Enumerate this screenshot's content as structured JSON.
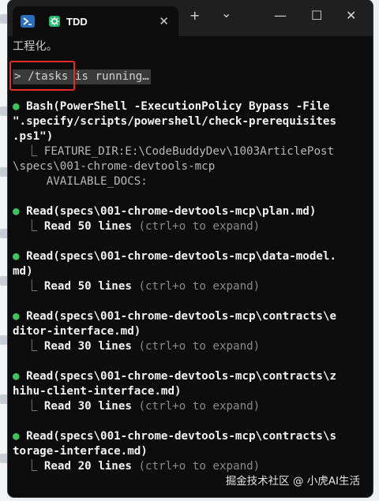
{
  "window": {
    "tab_title": "TDD",
    "new_tab": "+",
    "dropdown": "⌄",
    "minimize": "—",
    "maximize": "☐",
    "close": "✕"
  },
  "terminal": {
    "top_text": "工程化。",
    "prompt": "> /tasks is running…",
    "bash_call": "Bash(PowerShell -ExecutionPolicy Bypass -File",
    "bash_call_2": "\".specify/scripts/powershell/check-prerequisites",
    "bash_call_3": ".ps1\")",
    "bash_out_1": "  ⎿ FEATURE_DIR:E:\\CodeBuddyDev\\1003ArticlePost",
    "bash_out_2": "\\specs\\001-chrome-devtools-mcp",
    "bash_out_3": "     AVAILABLE_DOCS:",
    "reads": [
      {
        "call": "Read(specs\\001-chrome-devtools-mcp\\plan.md)",
        "call_2": "",
        "count": "50"
      },
      {
        "call": "Read(specs\\001-chrome-devtools-mcp\\data-model.",
        "call_2": "md)",
        "count": "50"
      },
      {
        "call": "Read(specs\\001-chrome-devtools-mcp\\contracts\\e",
        "call_2": "ditor-interface.md)",
        "count": "30"
      },
      {
        "call": "Read(specs\\001-chrome-devtools-mcp\\contracts\\z",
        "call_2": "hihu-client-interface.md)",
        "count": "30"
      },
      {
        "call": "Read(specs\\001-chrome-devtools-mcp\\contracts\\s",
        "call_2": "torage-interface.md)",
        "count": "20"
      }
    ],
    "read_word": "Read",
    "lines_word": "lines",
    "expand_hint": "(ctrl+o to expand)",
    "bullet": "●",
    "branch": "⎿"
  },
  "watermark": "掘金技术社区 @ 小虎AI生活"
}
